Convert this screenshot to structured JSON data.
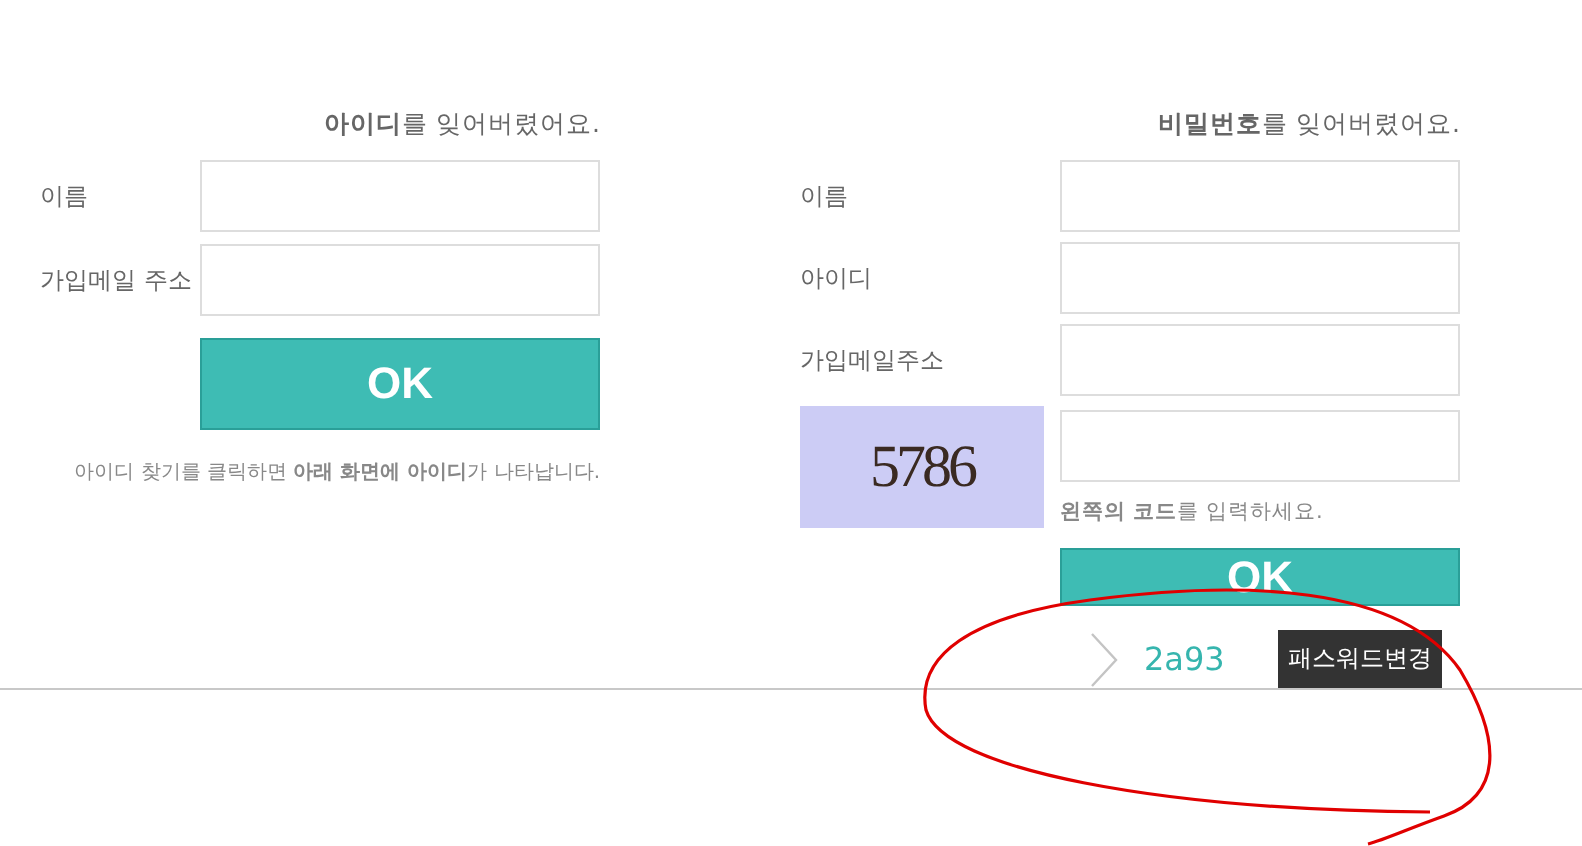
{
  "find_id": {
    "heading": "**아이디**를 잊어버렸어요.",
    "fields": [
      {
        "label": "이름"
      },
      {
        "label": "가입메일 주소"
      }
    ],
    "button": "OK",
    "note": "아이디 찾기를 클릭하면 **아래 화면에 아이디**가 나타납니다."
  },
  "find_password": {
    "heading": "**비밀번호**를 잊어버렸어요.",
    "fields": [
      {
        "label": "이름"
      },
      {
        "label": "아이디"
      },
      {
        "label": "가입메일주소"
      }
    ],
    "captcha": {
      "code": "5786",
      "hint": "**왼쪽의 코드**를 입력하세요."
    },
    "button": "OK",
    "result": {
      "code": "2a93",
      "action": "패스워드변경"
    }
  },
  "annotations": [
    {
      "kind": "circle"
    }
  ]
}
